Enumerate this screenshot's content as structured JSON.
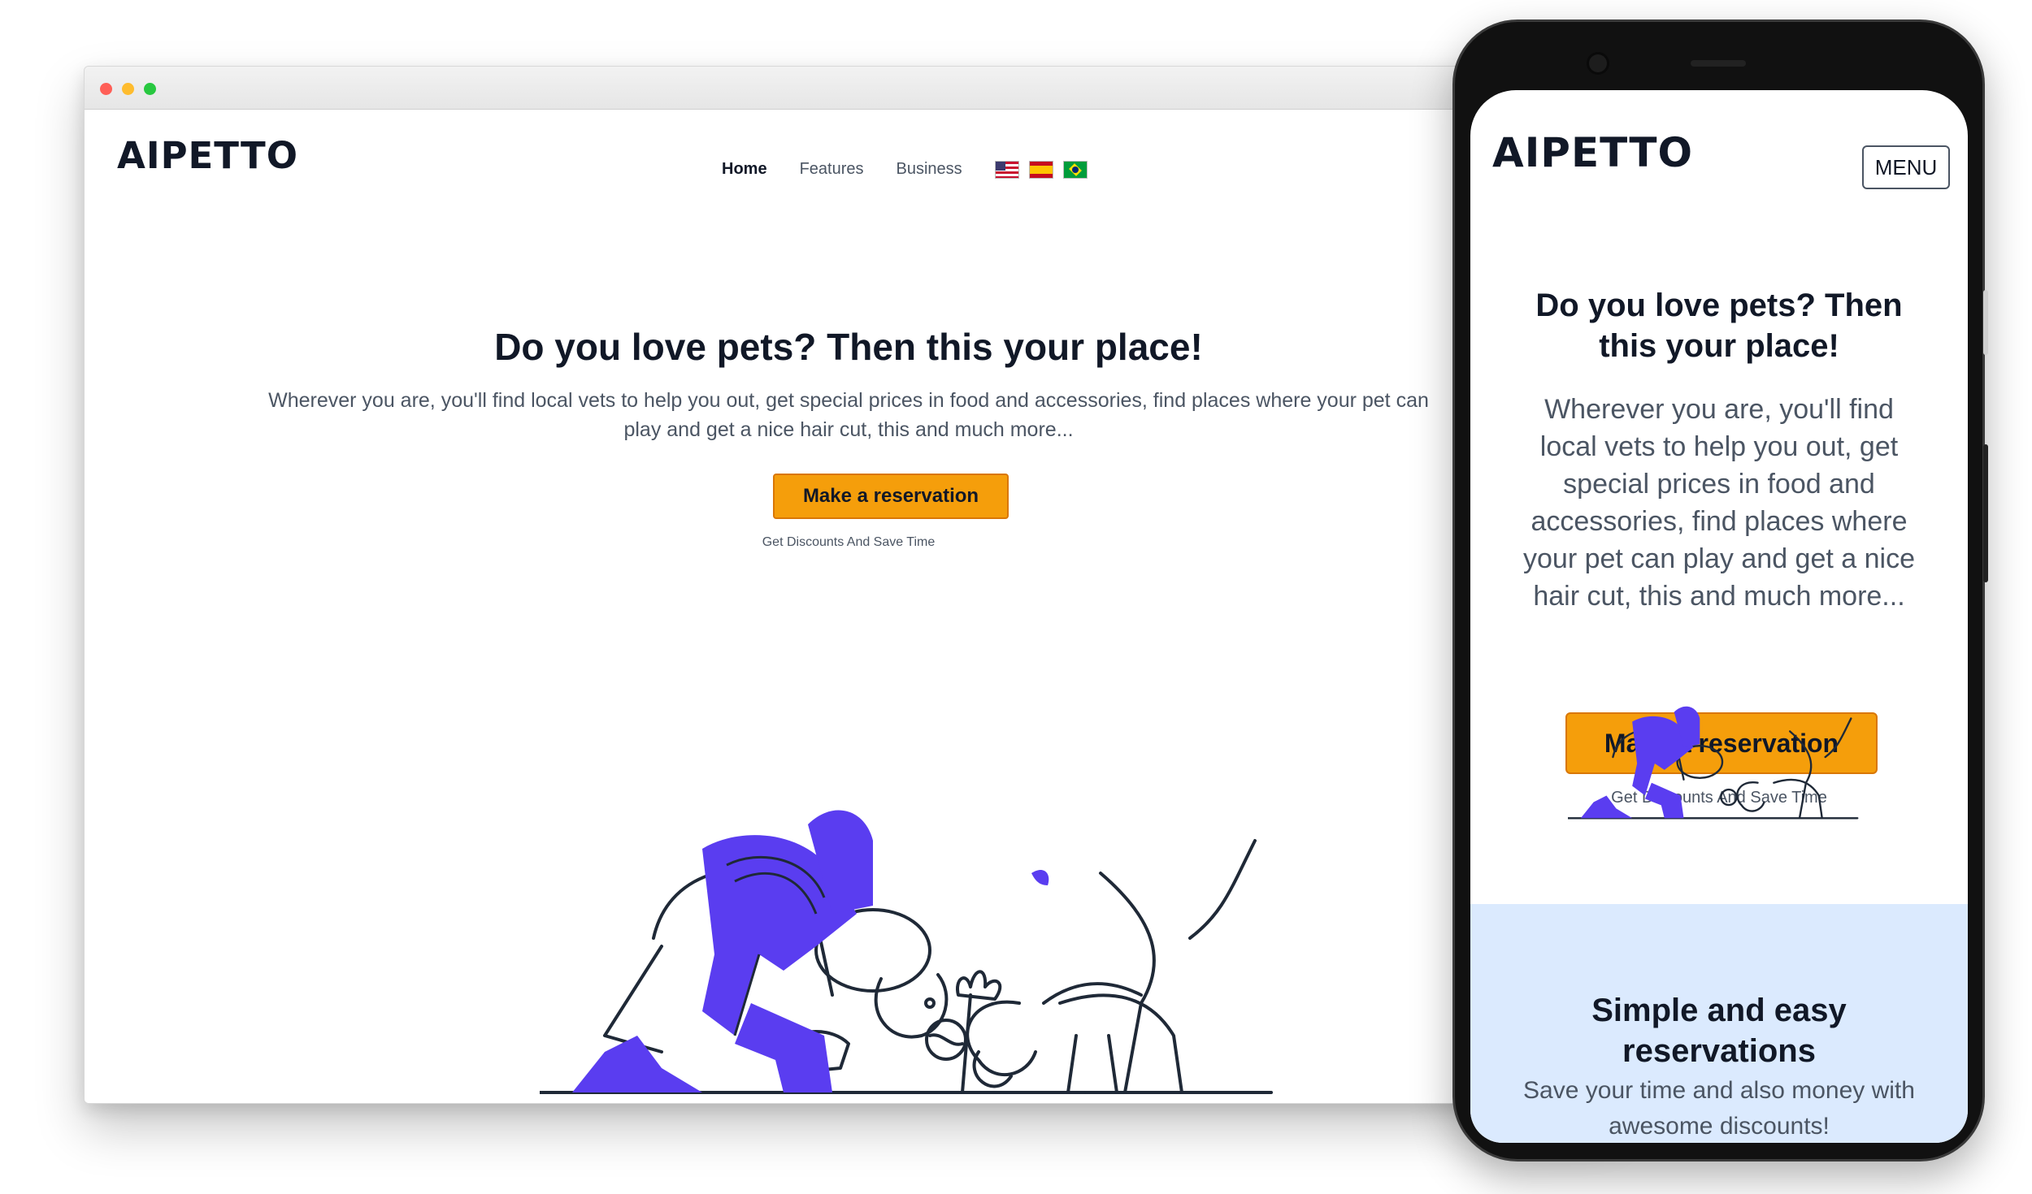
{
  "brand": "AIPETTO",
  "nav": {
    "items": [
      "Home",
      "Features",
      "Business"
    ],
    "active": "Home",
    "languages": [
      "us-flag",
      "es-flag",
      "br-flag"
    ]
  },
  "hero": {
    "title": "Do you love pets? Then this your place!",
    "desktop_description": "Wherever you are, you'll find local vets to help you out, get special prices in food and accessories, find places where your pet can play and get a nice hair cut, this and much more...",
    "mobile_title": "Do you love pets? Then this your place!",
    "mobile_description": "Wherever you are, you'll find local vets to help you out, get special prices in food and accessories, find places where your pet can play and get a nice hair cut, this and much more...",
    "cta_label": "Make a reservation",
    "cta_subtitle": "Get Discounts And Save Time"
  },
  "mobile": {
    "menu_label": "MENU",
    "section_title": "Simple and easy reservations",
    "section_description": "Save your time and also money with awesome discounts!"
  },
  "colors": {
    "accent": "#f59e0b",
    "illustration_purple": "#5a3df0",
    "section_bg": "#dbeafe",
    "text_dark": "#111827",
    "text_gray": "#4b5563"
  }
}
